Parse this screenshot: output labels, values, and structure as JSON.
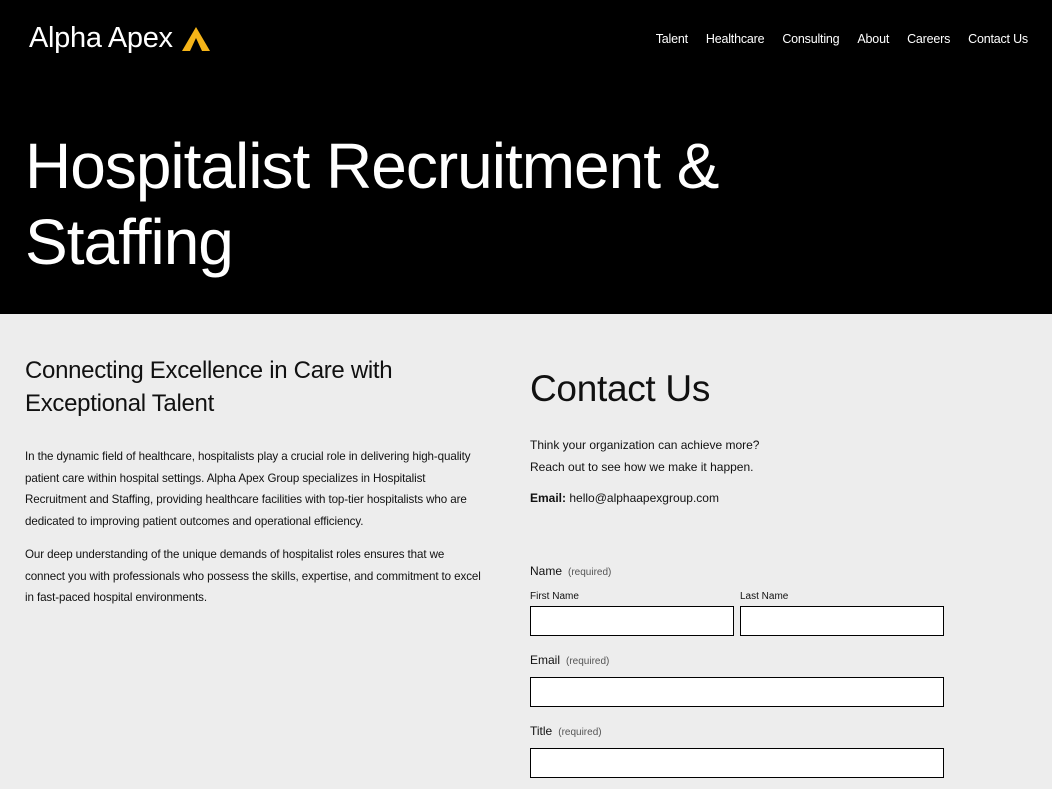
{
  "brand": {
    "name": "Alpha Apex",
    "mark_color": "#F5B418"
  },
  "nav": {
    "items": [
      {
        "label": "Talent",
        "name": "nav-talent"
      },
      {
        "label": "Healthcare",
        "name": "nav-healthcare"
      },
      {
        "label": "Consulting",
        "name": "nav-consulting"
      },
      {
        "label": "About",
        "name": "nav-about"
      },
      {
        "label": "Careers",
        "name": "nav-careers"
      },
      {
        "label": "Contact Us",
        "name": "nav-contact-us"
      }
    ]
  },
  "hero": {
    "title": "Hospitalist Recruitment & Staffing"
  },
  "intro": {
    "heading": "Connecting Excellence in Care with Exceptional Talent",
    "paragraphs": [
      "In the dynamic field of healthcare, hospitalists play a crucial role in delivering high-quality patient care within hospital settings. Alpha Apex Group specializes in Hospitalist Recruitment and Staffing, providing healthcare facilities with top-tier hospitalists who are dedicated to improving patient outcomes and operational efficiency.",
      "Our deep understanding of the unique demands of hospitalist roles ensures that we connect you with professionals who possess the skills, expertise, and commitment to excel in fast-paced hospital environments."
    ]
  },
  "contact": {
    "title": "Contact Us",
    "line1": "Think your organization can achieve more?",
    "line2": "Reach out to see how we make it happen.",
    "email_label": "Email:",
    "email_value": "hello@alphaapexgroup.com"
  },
  "form": {
    "required_text": "(required)",
    "name_label": "Name",
    "first_name_label": "First Name",
    "last_name_label": "Last Name",
    "email_label": "Email",
    "title_label": "Title",
    "first_name_value": "",
    "last_name_value": "",
    "email_value": "",
    "title_value": ""
  }
}
